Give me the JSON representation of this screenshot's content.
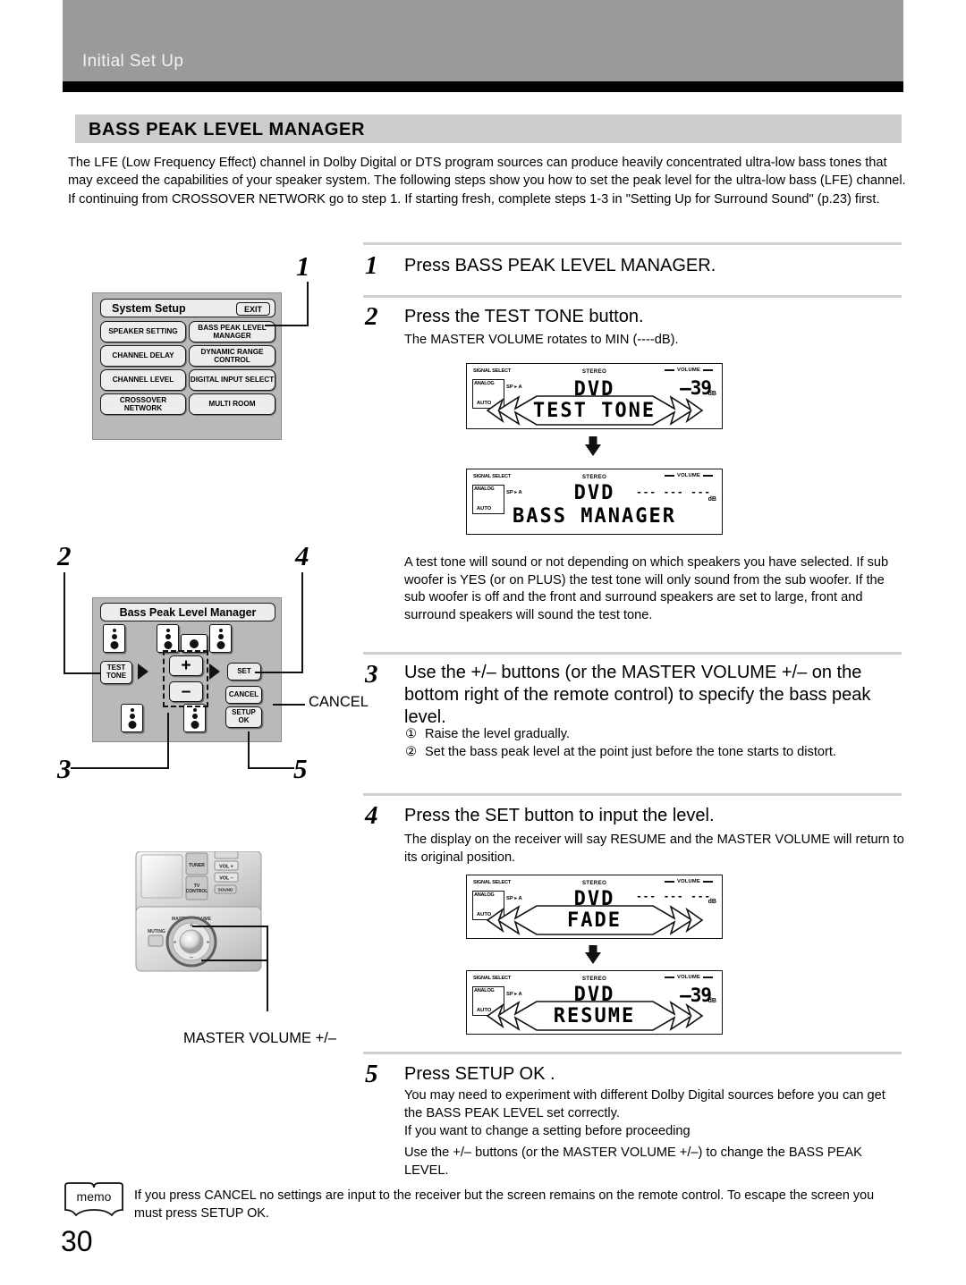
{
  "header": {
    "title": "Initial Set Up"
  },
  "section": {
    "title": "BASS PEAK LEVEL MANAGER"
  },
  "intro": "The LFE (Low Frequency Effect) channel in Dolby Digital or DTS program sources can produce heavily concentrated ultra-low bass tones that may exceed the capabilities of your speaker system. The following steps show you how to set the peak level for the ultra-low bass (LFE) channel.  If continuing from CROSSOVER NETWORK go to step 1. If starting fresh, complete steps 1-3 in \"Setting Up for Surround Sound\" (p.23) first.",
  "steps": {
    "s1": {
      "num": "1",
      "head": "Press BASS PEAK LEVEL MANAGER."
    },
    "s2": {
      "num": "2",
      "head": "Press the TEST TONE button.",
      "sub": "The MASTER VOLUME rotates to MIN (----dB).",
      "note": "A test tone will sound or not depending on which speakers you have selected. If sub woofer is YES (or on PLUS) the test tone will only sound from the sub woofer. If the sub woofer is off and the front and surround speakers are set to large, front and surround speakers will sound the test tone."
    },
    "s3": {
      "num": "3",
      "head": "Use the +/– buttons (or the MASTER VOLUME +/– on the bottom right of the remote control) to specify the bass peak level.",
      "list": [
        {
          "marker": "①",
          "text": "Raise the level gradually."
        },
        {
          "marker": "②",
          "text": "Set the bass peak level at the point just before the tone starts to distort."
        }
      ]
    },
    "s4": {
      "num": "4",
      "head": "Press the SET button to input the level.",
      "sub": "The display on the receiver will say RESUME and the MASTER VOLUME will return to its original position."
    },
    "s5": {
      "num": "5",
      "head": "Press SETUP OK .",
      "sub1": "You may need to experiment with different Dolby Digital sources before you can get the BASS PEAK LEVEL set correctly.",
      "sub2": "If you want to change a setting before proceeding",
      "sub3": "Use the +/– buttons (or the MASTER VOLUME +/–) to change the BASS PEAK LEVEL."
    }
  },
  "memo": {
    "label": "memo",
    "text": "If you press CANCEL no settings are input to the receiver but the screen remains on the remote control. To escape the screen you must press SETUP OK."
  },
  "page_number": "30",
  "system_setup": {
    "title": "System Setup",
    "exit_label": "EXIT",
    "buttons": [
      "SPEAKER SETTING",
      "BASS PEAK LEVEL MANAGER",
      "CHANNEL DELAY",
      "DYNAMIC RANGE CONTROL",
      "CHANNEL LEVEL",
      "DIGITAL INPUT SELECT",
      "CROSSOVER NETWORK",
      "MULTI ROOM"
    ]
  },
  "remote_panel": {
    "title": "Bass Peak Level Manager",
    "test_tone_label": "TEST TONE",
    "plus_label": "+",
    "minus_label": "–",
    "set_label": "SET",
    "cancel_label": "CANCEL",
    "setup_ok_label": "SETUP OK"
  },
  "callouts": {
    "c1": "1",
    "c2": "2",
    "c3a": "3",
    "c3b": "3",
    "c4": "4",
    "c5": "5",
    "cancel": "CANCEL",
    "master_volume": "MASTER VOLUME +/–"
  },
  "receiver_photo": {
    "tuner": "TUNER",
    "tv_control": "TV CONTROL",
    "vol_up": "VOL +",
    "vol_down": "VOL –",
    "sound": "SOUND",
    "muting": "MUTING",
    "master_volume": "MASTER VOLUME"
  },
  "displays": [
    {
      "id": "display-test-tone",
      "signal_select": "SIGNAL SELECT",
      "analog": "ANALOG",
      "auto": "AUTO",
      "sp": "SP ▸ A",
      "stereo": "STEREO",
      "volume": "VOLUME",
      "level": "–39",
      "db": "dB",
      "source": "DVD",
      "message": "TEST TONE",
      "burst": true
    },
    {
      "id": "display-bass-manager",
      "signal_select": "SIGNAL SELECT",
      "analog": "ANALOG",
      "auto": "AUTO",
      "sp": "SP ▸ A",
      "stereo": "STEREO",
      "volume": "VOLUME",
      "level": "--- --- ---",
      "db": "dB",
      "source": "DVD",
      "message": "BASS MANAGER",
      "burst": false
    },
    {
      "id": "display-fade",
      "signal_select": "SIGNAL SELECT",
      "analog": "ANALOG",
      "auto": "AUTO",
      "sp": "SP ▸ A",
      "stereo": "STEREO",
      "volume": "VOLUME",
      "level": "--- --- ---",
      "db": "dB",
      "source": "DVD",
      "message": "FADE",
      "burst": true
    },
    {
      "id": "display-resume",
      "signal_select": "SIGNAL SELECT",
      "analog": "ANALOG",
      "auto": "AUTO",
      "sp": "SP ▸ A",
      "stereo": "STEREO",
      "volume": "VOLUME",
      "level": "–39",
      "db": "dB",
      "source": "DVD",
      "message": "RESUME",
      "burst": true
    }
  ],
  "colors": {
    "header_band": "#9a9a9a",
    "section_band": "#cdcdcd",
    "panel_gray": "#b9b9b9",
    "rule_gray": "#d0d0d0"
  }
}
